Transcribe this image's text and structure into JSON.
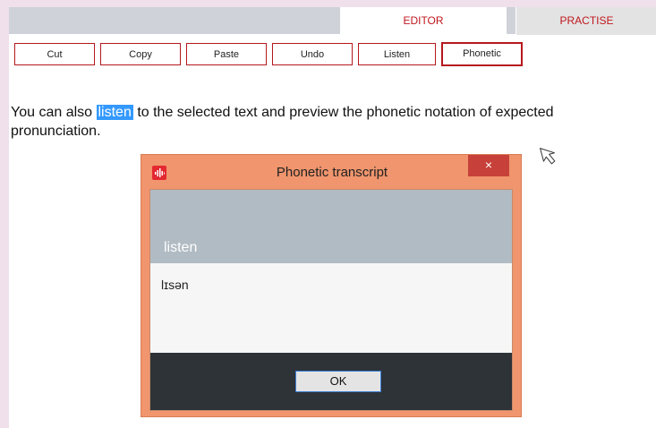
{
  "tabs": [
    {
      "label": "EDITOR"
    },
    {
      "label": "PRACTISE"
    }
  ],
  "toolbar": {
    "buttons": [
      {
        "label": "Cut"
      },
      {
        "label": "Copy"
      },
      {
        "label": "Paste"
      },
      {
        "label": "Undo"
      },
      {
        "label": "Listen"
      },
      {
        "label": "Phonetic"
      }
    ]
  },
  "content": {
    "text_before": "You can also",
    "highlighted": "listen",
    "text_after": "to the selected text and preview the phonetic notation of expected pronunciation."
  },
  "dialog": {
    "title": "Phonetic transcript",
    "close": "×",
    "word": "listen",
    "phonetic": "lɪsən",
    "ok_label": "OK"
  },
  "colors": {
    "accent": "#c0181e",
    "dialog_frame": "#f0956d",
    "selection": "#3399ff"
  },
  "icons": {
    "app": "sound-wave-icon",
    "cursor": "mouse-pointer-icon"
  }
}
